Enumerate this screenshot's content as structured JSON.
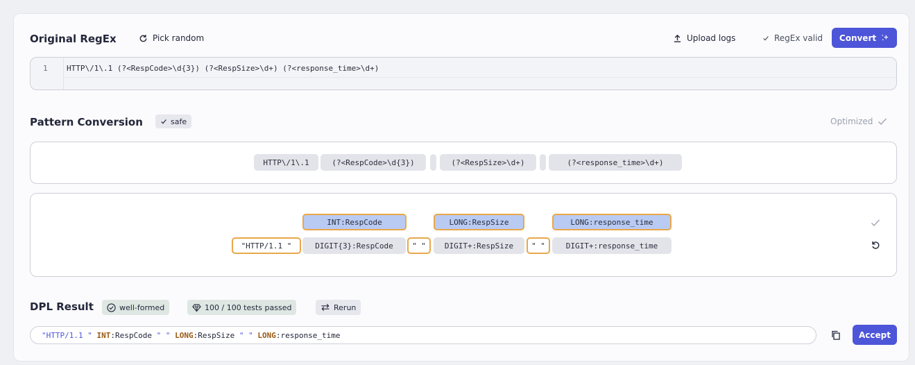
{
  "header": {
    "title": "Original RegEx",
    "pick_random": "Pick random",
    "upload_logs": "Upload logs",
    "regex_valid": "RegEx valid",
    "convert": "Convert"
  },
  "editor": {
    "line_number": "1",
    "code": "HTTP\\/1\\.1 (?<RespCode>\\d{3}) (?<RespSize>\\d+) (?<response_time>\\d+)"
  },
  "pattern": {
    "title": "Pattern Conversion",
    "safe_badge": "safe",
    "optimized": "Optimized",
    "tokens": [
      "HTTP\\/1\\.1",
      "(?<RespCode>\\d{3})",
      "(?<RespSize>\\d+)",
      "(?<response_time>\\d+)"
    ]
  },
  "mapping": {
    "types": [
      "INT:RespCode",
      "LONG:RespSize",
      "LONG:response_time"
    ],
    "matchers": [
      "\"HTTP/1.1 \"",
      "DIGIT{3}:RespCode",
      "\" \"",
      "DIGIT+:RespSize",
      "\" \"",
      "DIGIT+:response_time"
    ]
  },
  "dpl": {
    "title": "DPL Result",
    "well_formed": "well-formed",
    "tests_passed": "100 / 100 tests passed",
    "rerun": "Rerun",
    "accept": "Accept",
    "result_tokens": [
      {
        "t": "\"HTTP/1.1 \"",
        "k": "str"
      },
      {
        "t": " ",
        "k": "name"
      },
      {
        "t": "INT",
        "k": "type"
      },
      {
        "t": ":RespCode ",
        "k": "name"
      },
      {
        "t": "\" \"",
        "k": "str"
      },
      {
        "t": " ",
        "k": "name"
      },
      {
        "t": "LONG",
        "k": "type"
      },
      {
        "t": ":RespSize ",
        "k": "name"
      },
      {
        "t": "\" \"",
        "k": "str"
      },
      {
        "t": " ",
        "k": "name"
      },
      {
        "t": "LONG",
        "k": "type"
      },
      {
        "t": ":response_time",
        "k": "name"
      }
    ]
  },
  "colors": {
    "accent": "#4d55d8",
    "highlight_border": "#e8a74a",
    "type_fill": "#b9cbf3"
  }
}
